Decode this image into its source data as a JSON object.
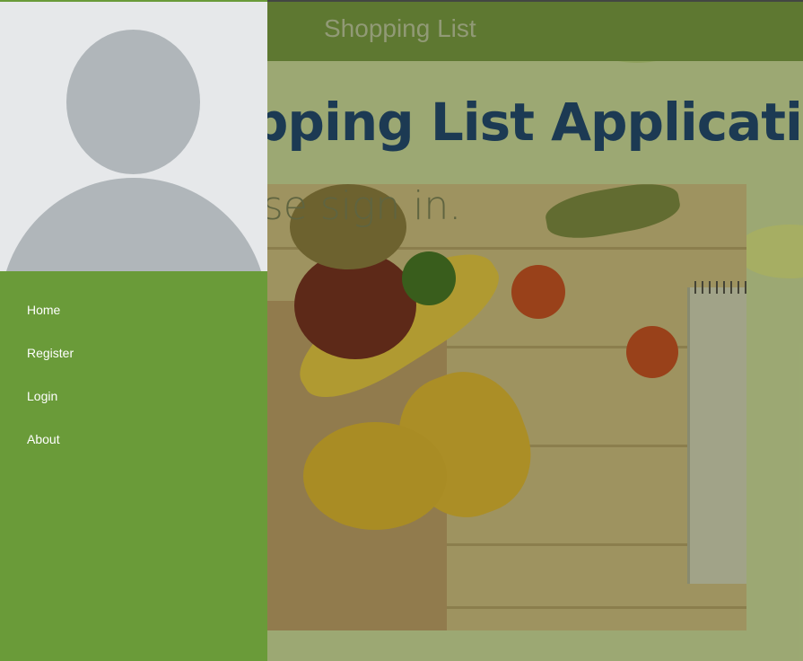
{
  "app": {
    "title": "Shopping List"
  },
  "main": {
    "heading": "Shopping List Application.",
    "heading_visible": "ng List Application.",
    "subheading": "Please sign in."
  },
  "drawer": {
    "items": [
      {
        "label": "Home"
      },
      {
        "label": "Register"
      },
      {
        "label": "Login"
      },
      {
        "label": "About"
      }
    ]
  },
  "colors": {
    "toolbar": "#6b8a3a",
    "drawer": "#6a9b39",
    "heading": "#1a3f63",
    "avatar": "#b0b6ba",
    "drawer_header": "#e6e8ea"
  },
  "icons": {
    "avatar": "user-placeholder-icon"
  }
}
